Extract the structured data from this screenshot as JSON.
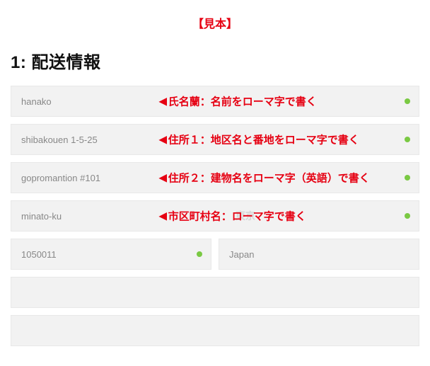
{
  "header": {
    "sample_label": "【見本】",
    "section_title": "1: 配送情報"
  },
  "fields": {
    "name": {
      "value": "hanako",
      "annotation": "氏名蘭：名前をローマ字で書く"
    },
    "address1": {
      "value": "shibakouen 1-5-25",
      "annotation": "住所１：地区名と番地をローマ字で書く"
    },
    "address2": {
      "value": "gopromantion #101",
      "annotation": "住所２：建物名をローマ字（英語）で書く"
    },
    "city": {
      "value": "minato-ku",
      "annotation": "市区町村名：ローマ字で書く",
      "ghost": "東京"
    },
    "postal": {
      "value": "1050011"
    },
    "country": {
      "value": "Japan"
    }
  }
}
